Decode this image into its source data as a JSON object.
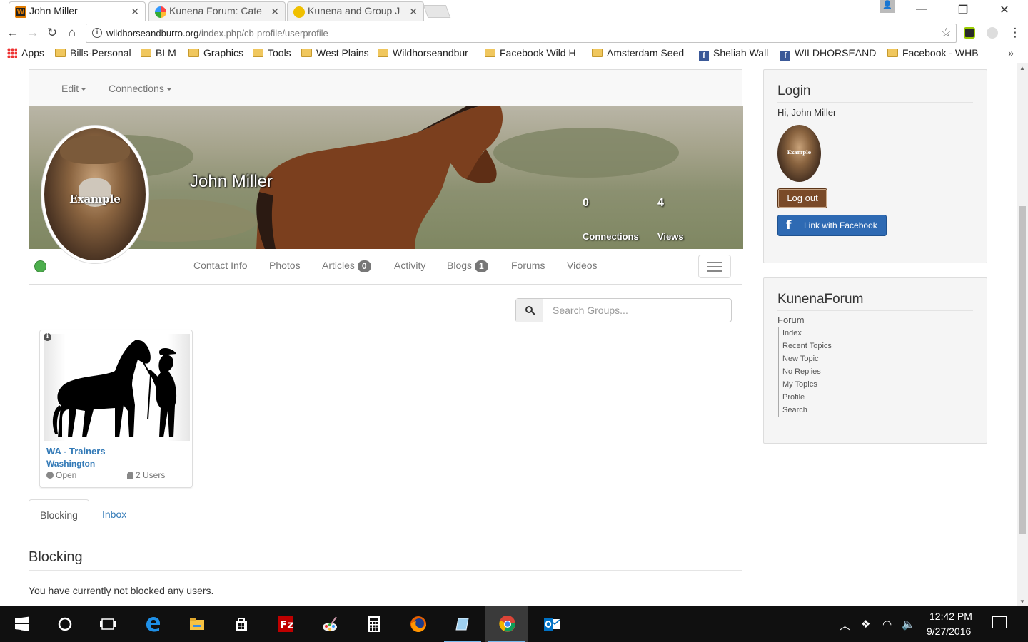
{
  "browser": {
    "tabs": [
      {
        "title": "John Miller",
        "active": true
      },
      {
        "title": "Kunena Forum: Cate",
        "active": false
      },
      {
        "title": "Kunena and Group J",
        "active": false
      }
    ],
    "url_host": "wildhorseandburro.org",
    "url_path": "/index.php/cb-profile/userprofile",
    "bookmarks": [
      "Apps",
      "Bills-Personal",
      "BLM",
      "Graphics",
      "Tools",
      "West Plains",
      "Wildhorseandbur",
      "Facebook Wild H",
      "Amsterdam Seed",
      "Sheliah Wall",
      "WILDHORSEAND",
      "Facebook - WHB"
    ],
    "bookmarks_more": "»"
  },
  "profile": {
    "menu": {
      "edit": "Edit",
      "connections": "Connections"
    },
    "name": "John Miller",
    "avatar_watermark": "Example",
    "stats": [
      {
        "value": "0",
        "label": "Connections"
      },
      {
        "value": "4",
        "label": "Views"
      }
    ],
    "tabs": [
      {
        "label": "Contact Info"
      },
      {
        "label": "Photos"
      },
      {
        "label": "Articles",
        "badge": "0"
      },
      {
        "label": "Activity"
      },
      {
        "label": "Blogs",
        "badge": "1"
      },
      {
        "label": "Forums"
      },
      {
        "label": "Videos"
      }
    ],
    "status_color": "#4cae4c"
  },
  "groups": {
    "search_placeholder": "Search Groups...",
    "items": [
      {
        "name": "WA - Trainers",
        "location": "Washington",
        "access": "Open",
        "users": "2 Users"
      }
    ]
  },
  "bottom_tabs": [
    {
      "label": "Blocking",
      "active": true
    },
    {
      "label": "Inbox",
      "active": false
    }
  ],
  "blocking": {
    "heading": "Blocking",
    "message": "You have currently not blocked any users."
  },
  "login_module": {
    "title": "Login",
    "greeting": "Hi, John Miller",
    "avatar_watermark": "Example",
    "logout_label": "Log out",
    "facebook_label": "Link with Facebook"
  },
  "forum_module": {
    "title": "KunenaForum",
    "parent": "Forum",
    "links": [
      "Index",
      "Recent Topics",
      "New Topic",
      "No Replies",
      "My Topics",
      "Profile",
      "Search"
    ]
  },
  "taskbar": {
    "time": "12:42 PM",
    "date": "9/27/2016",
    "apps": [
      "start",
      "cortana",
      "task-view",
      "edge",
      "file-explorer",
      "store",
      "filezilla",
      "paint",
      "calculator",
      "firefox",
      "notepad",
      "chrome",
      "outlook"
    ]
  }
}
